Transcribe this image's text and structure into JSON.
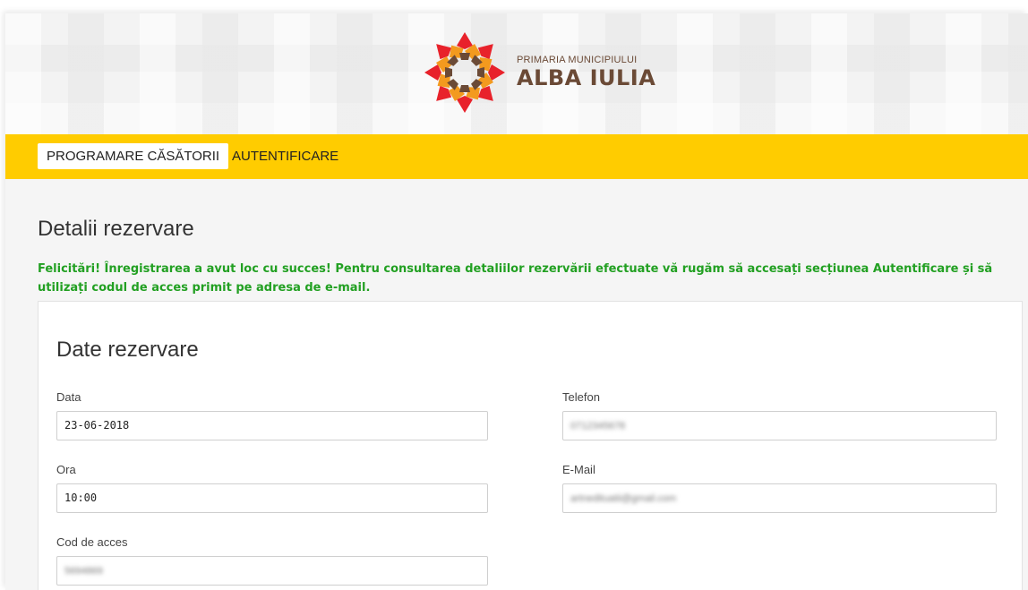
{
  "header": {
    "logo_small": "PRIMARIA MUNICIPIULUI",
    "logo_big": "ALBA IULIA",
    "colors": {
      "red": "#e8222b",
      "orange": "#f39a1e",
      "brown": "#6b4a36"
    }
  },
  "nav": {
    "items": [
      {
        "label": "PROGRAMARE CĂSĂTORII",
        "active": true
      },
      {
        "label": "AUTENTIFICARE",
        "active": false
      }
    ],
    "background": "#ffcc00"
  },
  "main": {
    "title": "Detalii rezervare",
    "success_message": "Felicitări! Înregistrarea a avut loc cu succes! Pentru consultarea detaliilor rezervării efectuate vă rugăm să accesați secțiunea Autentificare și să utilizați codul de acces primit pe adresa de e-mail.",
    "success_color": "#22a022"
  },
  "form": {
    "title": "Date rezervare",
    "fields": {
      "data": {
        "label": "Data",
        "value": "23-06-2018"
      },
      "ora": {
        "label": "Ora",
        "value": "10:00"
      },
      "cod": {
        "label": "Cod de acces",
        "value": "5694869"
      },
      "telefon": {
        "label": "Telefon",
        "value": "0712345678"
      },
      "email": {
        "label": "E-Mail",
        "value": "artnedituatii@gmail.com"
      }
    }
  }
}
